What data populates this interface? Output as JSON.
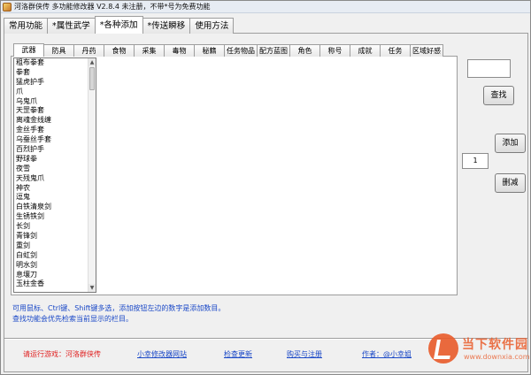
{
  "window": {
    "title": "河洛群侠传 多功能修改器 V2.8.4 未注册，不带*号为免费功能"
  },
  "main_tabs": [
    {
      "label": "常用功能",
      "active": false
    },
    {
      "label": "*属性武学",
      "active": false
    },
    {
      "label": "*各种添加",
      "active": true
    },
    {
      "label": "*传送瞬移",
      "active": false
    },
    {
      "label": "使用方法",
      "active": false
    }
  ],
  "sub_tabs": [
    {
      "label": "武器",
      "active": true
    },
    {
      "label": "防具"
    },
    {
      "label": "丹药"
    },
    {
      "label": "食物"
    },
    {
      "label": "采集"
    },
    {
      "label": "毒物"
    },
    {
      "label": "秘籍"
    },
    {
      "label": "任务物品"
    },
    {
      "label": "配方蓝图"
    },
    {
      "label": "角色"
    },
    {
      "label": "称号"
    },
    {
      "label": "成就"
    },
    {
      "label": "任务"
    },
    {
      "label": "区域好感"
    }
  ],
  "item_list": [
    "粗布拳套",
    "拳套",
    "猛虎护手",
    "爪",
    "乌鬼爪",
    "天罡拳套",
    "离魂金线缠",
    "金丝手套",
    "乌蚕丝手套",
    "百烈护手",
    "野球拳",
    "夜雪",
    "天残鬼爪",
    "神农",
    "逗鬼",
    "白铁清泉剑",
    "生锈铁剑",
    "长剑",
    "青锋剑",
    "重剑",
    "白虹剑",
    "明水剑",
    "息壤刀",
    "玉柱金香"
  ],
  "controls": {
    "search_value": "",
    "search_button": "查找",
    "add_button": "添加",
    "quantity": "1",
    "delete_button": "删减"
  },
  "hints": {
    "line1": "可用鼠标、Ctrl键、Shift键多选，添加按钮左边的数字是添加数目。",
    "line2": "查找功能会优先检索当前显示的栏目。"
  },
  "footer": {
    "run_game": "请运行游戏：河洛群侠传",
    "website": "小幸修改器网站",
    "update": "检查更新",
    "buy": "购买与注册",
    "author": "作者：@小幸姐"
  },
  "watermark": {
    "name": "当下软件园",
    "url": "www.downxia.com"
  },
  "colors": {
    "hint_blue": "#1a48c7",
    "warning_red": "#e02020",
    "window_bg": "#f0f0f0"
  }
}
